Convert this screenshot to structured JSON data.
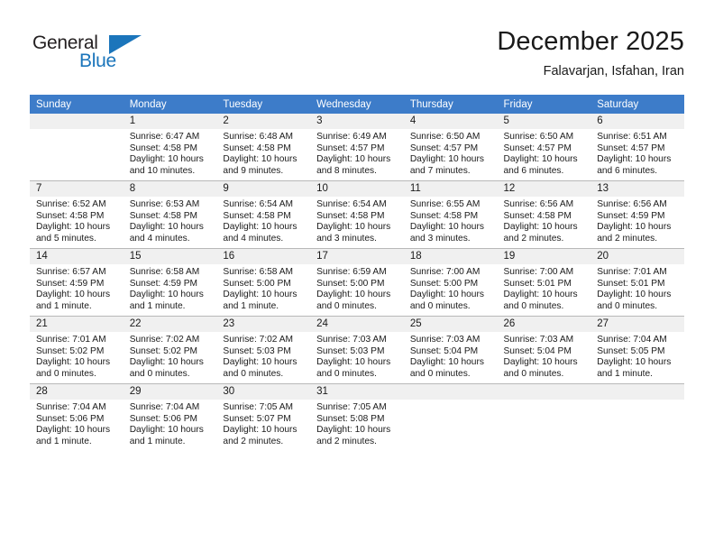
{
  "brand": {
    "name_part1": "General",
    "name_part2": "Blue",
    "accent_color": "#1b75bb"
  },
  "header": {
    "title": "December 2025",
    "subtitle": "Falavarjan, Isfahan, Iran"
  },
  "theme": {
    "header_band_color": "#3d7cc9",
    "daynum_strip_color": "#f0f0f0",
    "grid_line_color": "#b8b8b8"
  },
  "weekdays": [
    "Sunday",
    "Monday",
    "Tuesday",
    "Wednesday",
    "Thursday",
    "Friday",
    "Saturday"
  ],
  "weeks": [
    [
      {
        "day": "",
        "lines": []
      },
      {
        "day": "1",
        "lines": [
          "Sunrise: 6:47 AM",
          "Sunset: 4:58 PM",
          "Daylight: 10 hours",
          "and 10 minutes."
        ]
      },
      {
        "day": "2",
        "lines": [
          "Sunrise: 6:48 AM",
          "Sunset: 4:58 PM",
          "Daylight: 10 hours",
          "and 9 minutes."
        ]
      },
      {
        "day": "3",
        "lines": [
          "Sunrise: 6:49 AM",
          "Sunset: 4:57 PM",
          "Daylight: 10 hours",
          "and 8 minutes."
        ]
      },
      {
        "day": "4",
        "lines": [
          "Sunrise: 6:50 AM",
          "Sunset: 4:57 PM",
          "Daylight: 10 hours",
          "and 7 minutes."
        ]
      },
      {
        "day": "5",
        "lines": [
          "Sunrise: 6:50 AM",
          "Sunset: 4:57 PM",
          "Daylight: 10 hours",
          "and 6 minutes."
        ]
      },
      {
        "day": "6",
        "lines": [
          "Sunrise: 6:51 AM",
          "Sunset: 4:57 PM",
          "Daylight: 10 hours",
          "and 6 minutes."
        ]
      }
    ],
    [
      {
        "day": "7",
        "lines": [
          "Sunrise: 6:52 AM",
          "Sunset: 4:58 PM",
          "Daylight: 10 hours",
          "and 5 minutes."
        ]
      },
      {
        "day": "8",
        "lines": [
          "Sunrise: 6:53 AM",
          "Sunset: 4:58 PM",
          "Daylight: 10 hours",
          "and 4 minutes."
        ]
      },
      {
        "day": "9",
        "lines": [
          "Sunrise: 6:54 AM",
          "Sunset: 4:58 PM",
          "Daylight: 10 hours",
          "and 4 minutes."
        ]
      },
      {
        "day": "10",
        "lines": [
          "Sunrise: 6:54 AM",
          "Sunset: 4:58 PM",
          "Daylight: 10 hours",
          "and 3 minutes."
        ]
      },
      {
        "day": "11",
        "lines": [
          "Sunrise: 6:55 AM",
          "Sunset: 4:58 PM",
          "Daylight: 10 hours",
          "and 3 minutes."
        ]
      },
      {
        "day": "12",
        "lines": [
          "Sunrise: 6:56 AM",
          "Sunset: 4:58 PM",
          "Daylight: 10 hours",
          "and 2 minutes."
        ]
      },
      {
        "day": "13",
        "lines": [
          "Sunrise: 6:56 AM",
          "Sunset: 4:59 PM",
          "Daylight: 10 hours",
          "and 2 minutes."
        ]
      }
    ],
    [
      {
        "day": "14",
        "lines": [
          "Sunrise: 6:57 AM",
          "Sunset: 4:59 PM",
          "Daylight: 10 hours",
          "and 1 minute."
        ]
      },
      {
        "day": "15",
        "lines": [
          "Sunrise: 6:58 AM",
          "Sunset: 4:59 PM",
          "Daylight: 10 hours",
          "and 1 minute."
        ]
      },
      {
        "day": "16",
        "lines": [
          "Sunrise: 6:58 AM",
          "Sunset: 5:00 PM",
          "Daylight: 10 hours",
          "and 1 minute."
        ]
      },
      {
        "day": "17",
        "lines": [
          "Sunrise: 6:59 AM",
          "Sunset: 5:00 PM",
          "Daylight: 10 hours",
          "and 0 minutes."
        ]
      },
      {
        "day": "18",
        "lines": [
          "Sunrise: 7:00 AM",
          "Sunset: 5:00 PM",
          "Daylight: 10 hours",
          "and 0 minutes."
        ]
      },
      {
        "day": "19",
        "lines": [
          "Sunrise: 7:00 AM",
          "Sunset: 5:01 PM",
          "Daylight: 10 hours",
          "and 0 minutes."
        ]
      },
      {
        "day": "20",
        "lines": [
          "Sunrise: 7:01 AM",
          "Sunset: 5:01 PM",
          "Daylight: 10 hours",
          "and 0 minutes."
        ]
      }
    ],
    [
      {
        "day": "21",
        "lines": [
          "Sunrise: 7:01 AM",
          "Sunset: 5:02 PM",
          "Daylight: 10 hours",
          "and 0 minutes."
        ]
      },
      {
        "day": "22",
        "lines": [
          "Sunrise: 7:02 AM",
          "Sunset: 5:02 PM",
          "Daylight: 10 hours",
          "and 0 minutes."
        ]
      },
      {
        "day": "23",
        "lines": [
          "Sunrise: 7:02 AM",
          "Sunset: 5:03 PM",
          "Daylight: 10 hours",
          "and 0 minutes."
        ]
      },
      {
        "day": "24",
        "lines": [
          "Sunrise: 7:03 AM",
          "Sunset: 5:03 PM",
          "Daylight: 10 hours",
          "and 0 minutes."
        ]
      },
      {
        "day": "25",
        "lines": [
          "Sunrise: 7:03 AM",
          "Sunset: 5:04 PM",
          "Daylight: 10 hours",
          "and 0 minutes."
        ]
      },
      {
        "day": "26",
        "lines": [
          "Sunrise: 7:03 AM",
          "Sunset: 5:04 PM",
          "Daylight: 10 hours",
          "and 0 minutes."
        ]
      },
      {
        "day": "27",
        "lines": [
          "Sunrise: 7:04 AM",
          "Sunset: 5:05 PM",
          "Daylight: 10 hours",
          "and 1 minute."
        ]
      }
    ],
    [
      {
        "day": "28",
        "lines": [
          "Sunrise: 7:04 AM",
          "Sunset: 5:06 PM",
          "Daylight: 10 hours",
          "and 1 minute."
        ]
      },
      {
        "day": "29",
        "lines": [
          "Sunrise: 7:04 AM",
          "Sunset: 5:06 PM",
          "Daylight: 10 hours",
          "and 1 minute."
        ]
      },
      {
        "day": "30",
        "lines": [
          "Sunrise: 7:05 AM",
          "Sunset: 5:07 PM",
          "Daylight: 10 hours",
          "and 2 minutes."
        ]
      },
      {
        "day": "31",
        "lines": [
          "Sunrise: 7:05 AM",
          "Sunset: 5:08 PM",
          "Daylight: 10 hours",
          "and 2 minutes."
        ]
      },
      {
        "day": "",
        "lines": []
      },
      {
        "day": "",
        "lines": []
      },
      {
        "day": "",
        "lines": []
      }
    ]
  ]
}
